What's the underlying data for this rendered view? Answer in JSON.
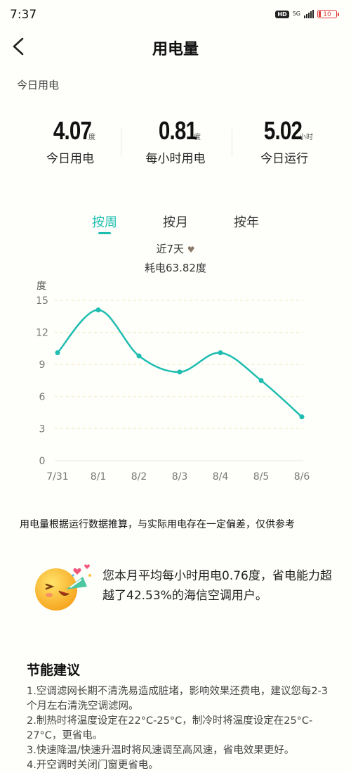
{
  "status": {
    "time": "7:37",
    "hd": "HD",
    "network": "5G",
    "battery": "10"
  },
  "header": {
    "title": "用电量",
    "back_icon": "chevron-left-icon"
  },
  "section_label": "今日用电",
  "stats": [
    {
      "value": "4.07",
      "unit": "度",
      "label": "今日用电"
    },
    {
      "value": "0.81",
      "unit": "度",
      "label": "每小时用电"
    },
    {
      "value": "5.02",
      "unit": "小时",
      "label": "今日运行"
    }
  ],
  "tabs": [
    {
      "label": "按周",
      "active": true
    },
    {
      "label": "按月",
      "active": false
    },
    {
      "label": "按年",
      "active": false
    }
  ],
  "range": {
    "label": "近7天",
    "icon": "heart-icon"
  },
  "consumption": "耗电63.82度",
  "chart_data": {
    "type": "line",
    "ylabel": "度",
    "categories": [
      "7/31",
      "8/1",
      "8/2",
      "8/3",
      "8/4",
      "8/5",
      "8/6"
    ],
    "values": [
      10.1,
      14.1,
      9.8,
      8.3,
      10.1,
      7.5,
      4.1
    ],
    "yticks": [
      "15",
      "12",
      "9",
      "6",
      "3",
      "0"
    ],
    "ylim": [
      0,
      15
    ],
    "grid": "dashed-horizontal",
    "color": "#1ebdb0"
  },
  "disclaimer": "用电量根据运行数据推算，与实际用电存在一定偏差，仅供参考",
  "summary": "您本月平均每小时用电0.76度，省电能力超越了42.53%的海信空调用户。",
  "tips": {
    "title": "节能建议",
    "items": [
      "1.空调滤网长期不清洗易造成脏堵，影响效果还费电，建议您每2-3个月左右清洗空调滤网。",
      "2.制热时将温度设定在22°C-25°C，制冷时将温度设定在25°C-27°C，更省电。",
      "3.快速降温/快速升温时将风速调至高风速，省电效果更好。",
      "4.开空调时关闭门窗更省电。"
    ]
  }
}
